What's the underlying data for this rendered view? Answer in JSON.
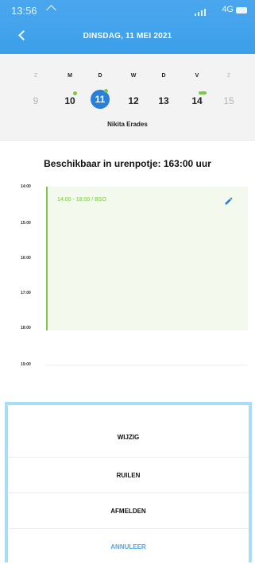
{
  "status_bar": {
    "time": "13:56",
    "network": "4G"
  },
  "header": {
    "title": "DINSDAG, 11 MEI 2021"
  },
  "week": {
    "days": [
      {
        "letter": "Z",
        "number": "9",
        "dim": true
      },
      {
        "letter": "M",
        "number": "10",
        "dim": false,
        "marker": "dot"
      },
      {
        "letter": "D",
        "number": "11",
        "dim": false,
        "selected": true,
        "marker": "dot"
      },
      {
        "letter": "W",
        "number": "12",
        "dim": false
      },
      {
        "letter": "D",
        "number": "13",
        "dim": false
      },
      {
        "letter": "V",
        "number": "14",
        "dim": false,
        "marker": "dash"
      },
      {
        "letter": "Z",
        "number": "15",
        "dim": true
      }
    ],
    "person": "Nikita Erades",
    "marker_color": "#7cc84a",
    "selected_color": "#2a7fd8"
  },
  "schedule": {
    "balance": "Beschikbaar in urenpotje: 163:00 uur",
    "hours": [
      "14:00",
      "15:00",
      "16:00",
      "17:00",
      "18:00",
      "19:00"
    ],
    "appointment": {
      "text": "14:00 - 18:00 / BSO",
      "color": "#7cc84a"
    },
    "edit_icon": "pencil-icon"
  },
  "actions": {
    "edit": "WIJZIG",
    "swap": "RUILEN",
    "cancel_shift": "AFMELDEN",
    "dismiss": "ANNULEER"
  },
  "colors": {
    "header": "#4aa7ee",
    "accent": "#4aa7ee",
    "sheet_border": "#a7ddf6"
  }
}
